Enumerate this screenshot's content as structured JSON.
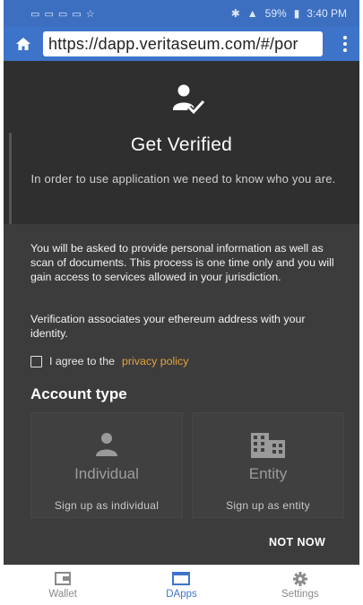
{
  "status_bar": {
    "left_icons": "▭ ▭ ▭ ▭ ☆",
    "right": {
      "bluetooth": "✱",
      "signal": "▲",
      "battery": "59%",
      "time": "3:40 PM"
    }
  },
  "browser": {
    "url": "https://dapp.veritaseum.com/#/por",
    "icons": {
      "home": "home-icon",
      "menu": "more-vert-icon"
    }
  },
  "hero": {
    "title": "Get Verified",
    "subtitle": "In order to use application we need to know who you are.",
    "icon": "verified-user-icon"
  },
  "content": {
    "paragraph1": "You will be asked to provide personal information as well as scan of documents. This process is one time only and you will gain access to services allowed in your jurisdiction.",
    "paragraph2": "Verification associates your ethereum address with your identity.",
    "agree_prefix": "I agree to the",
    "agree_link": "privacy policy",
    "account_type_title": "Account type",
    "cards": [
      {
        "title": "Individual",
        "subtitle": "Sign up as individual",
        "icon": "person-icon"
      },
      {
        "title": "Entity",
        "subtitle": "Sign up as entity",
        "icon": "building-icon"
      }
    ],
    "not_now": "NOT NOW"
  },
  "bottom_nav": {
    "items": [
      {
        "label": "Wallet",
        "icon": "wallet-icon",
        "active": false
      },
      {
        "label": "DApps",
        "icon": "dapps-icon",
        "active": true
      },
      {
        "label": "Settings",
        "icon": "settings-icon",
        "active": false
      }
    ]
  },
  "colors": {
    "accent": "#3d74c9",
    "link": "#e6a23c",
    "background": "#3c3c3c"
  }
}
